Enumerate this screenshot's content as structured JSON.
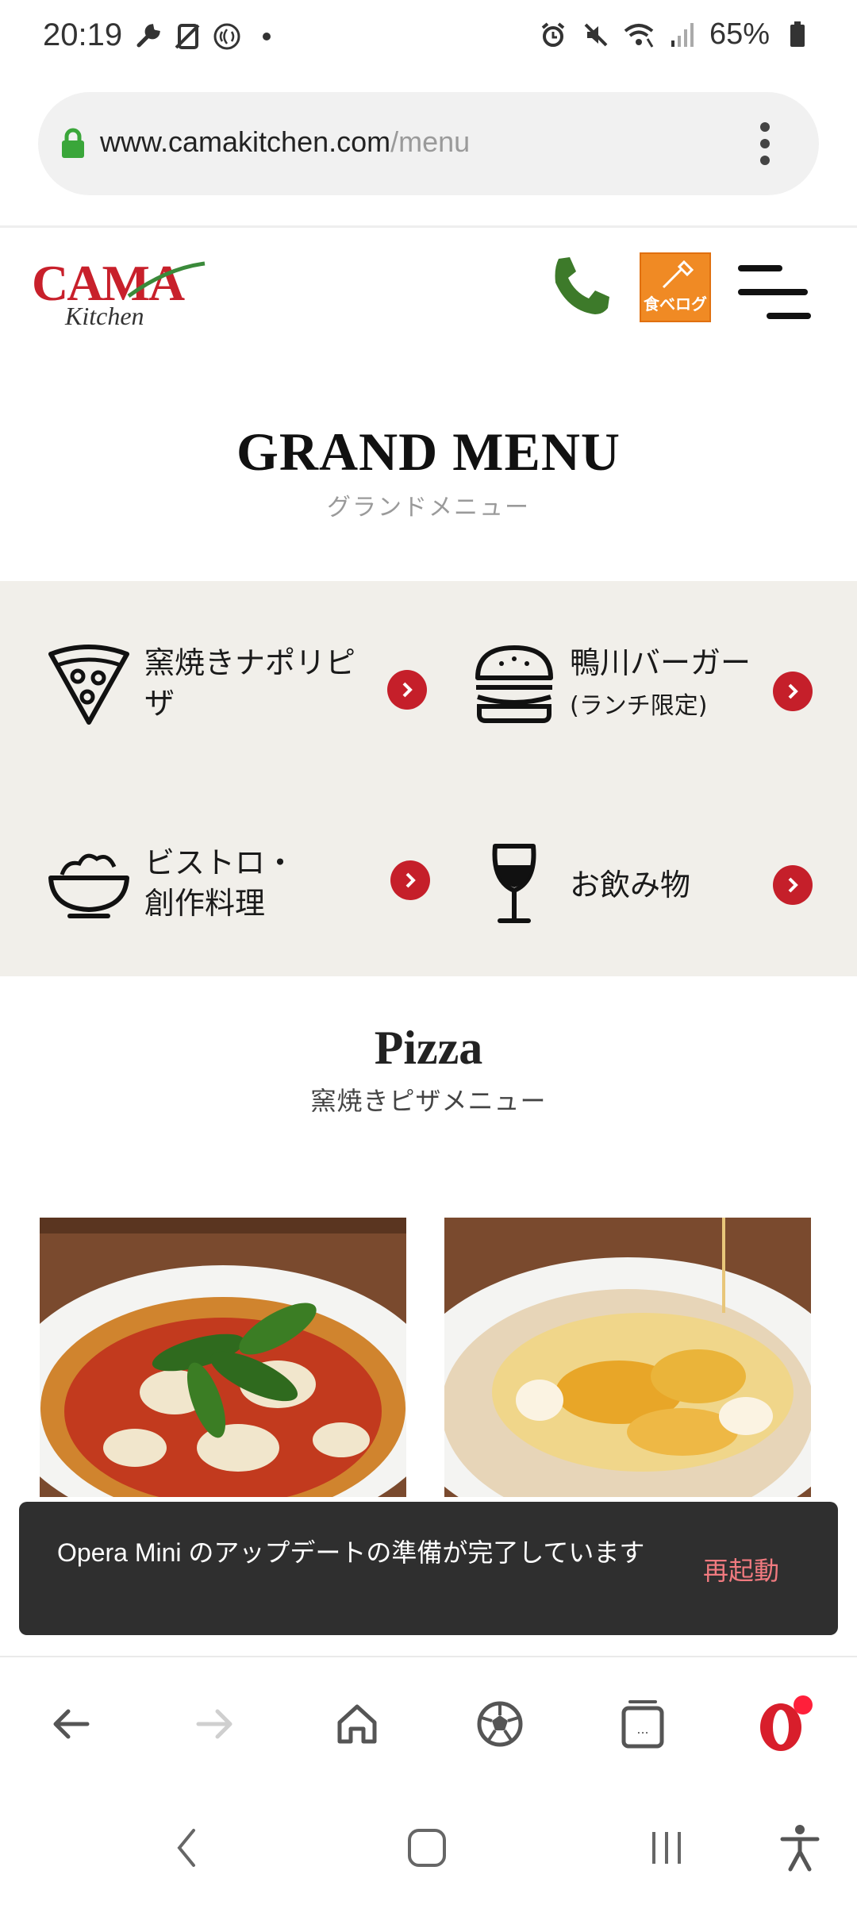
{
  "status_bar": {
    "time": "20:19",
    "battery": "65%",
    "left_icons": [
      "wrench-icon",
      "no-sim-icon",
      "nfc-icon",
      "dot-icon"
    ],
    "right_icons": [
      "alarm-icon",
      "mute-icon",
      "wifi-icon",
      "signal-icon",
      "battery-icon"
    ]
  },
  "address_bar": {
    "domain": "www.camakitchen.com",
    "path": "/menu"
  },
  "header": {
    "logo_text": "CAMA",
    "logo_sub": "Kitchen",
    "tabelog_label": "食べログ"
  },
  "grand_menu": {
    "title": "GRAND MENU",
    "subtitle": "グランドメニュー"
  },
  "categories": [
    {
      "label_line1": "窯焼きナポリピ",
      "label_line2": "ザ",
      "icon": "pizza-slice-icon"
    },
    {
      "label_line1": "鴨川バーガー",
      "label_line2": "(ランチ限定)",
      "icon": "burger-icon"
    },
    {
      "label_line1": "ビストロ・",
      "label_line2": "創作料理",
      "icon": "salad-bowl-icon"
    },
    {
      "label_line1": "お飲み物",
      "label_line2": "",
      "icon": "wine-glass-icon"
    }
  ],
  "pizza_section": {
    "title": "Pizza",
    "subtitle": "窯焼きピザメニュー"
  },
  "toast": {
    "message": "Opera Mini のアップデートの準備が完了しています",
    "action": "再起動"
  },
  "toolbar": {
    "buttons": [
      "back-icon",
      "forward-icon",
      "home-icon",
      "soccer-ball-icon",
      "tabs-icon",
      "opera-icon"
    ],
    "tabs_label": "...",
    "colors": {
      "accent_red": "#c51f2a",
      "phone_green": "#3d7a2a",
      "tabelog_orange": "#f08a24"
    }
  },
  "nav_bar": {
    "buttons": [
      "nav-back-icon",
      "nav-home-icon",
      "nav-recents-icon",
      "accessibility-icon"
    ]
  }
}
